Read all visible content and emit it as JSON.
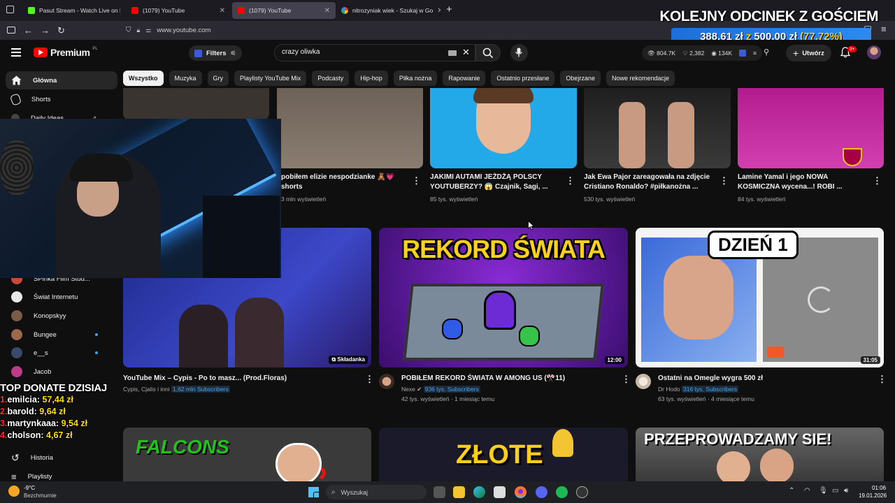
{
  "browser": {
    "tabs": [
      {
        "title": "Pasut Stream - Watch Live on K",
        "active": false
      },
      {
        "title": "(1079) YouTube",
        "active": false
      },
      {
        "title": "(1079) YouTube",
        "active": true
      },
      {
        "title": "nitrozyniak wiek - Szukaj w Go",
        "active": false
      }
    ],
    "url": "www.youtube.com"
  },
  "overlay": {
    "title": "KOLEJNY ODCINEK Z GOŚCIEM",
    "current": "388,61 zł",
    "z": "z",
    "goal": "500,00 zł",
    "percent": "(77.72%)",
    "progress_fraction": 0.7772,
    "top_title": "TOP DONATE DZISIAJ",
    "top": [
      {
        "rank": "1.",
        "name": "emilcia:",
        "amount": "57,44 zł"
      },
      {
        "rank": "2.",
        "name": "barold:",
        "amount": "9,64 zł"
      },
      {
        "rank": "3.",
        "name": "martynkaaa:",
        "amount": "9,54 zł"
      },
      {
        "rank": "4.",
        "name": "cholson:",
        "amount": "4,67 zł"
      }
    ]
  },
  "header": {
    "logo": "Premium",
    "logo_region": "PL",
    "filters": "Filters",
    "search_value": "crazy oliwka",
    "stats": {
      "views": "804.7K",
      "likes": "2,382",
      "watch": "134K"
    },
    "create": "Utwórz",
    "notif_badge": "9+"
  },
  "chips": [
    "Wszystko",
    "Muzyka",
    "Gry",
    "Playlisty YouTube Mix",
    "Podcasty",
    "Hip-hop",
    "Piłka nożna",
    "Rapowanie",
    "Ostatnio przesłane",
    "Obejrzane",
    "Nowe rekomendacje"
  ],
  "sidebar": {
    "main": [
      {
        "label": "Główna"
      },
      {
        "label": "Shorts"
      },
      {
        "label": "Daily Ideas"
      }
    ],
    "subs": [
      {
        "label": "SPinka Film Stud..."
      },
      {
        "label": "Świat Internetu"
      },
      {
        "label": "Konopskyy"
      },
      {
        "label": "Bungee"
      },
      {
        "label": "e__s"
      },
      {
        "label": "Jacob"
      }
    ],
    "bottom": [
      {
        "label": "Historia"
      },
      {
        "label": "Playlisty"
      }
    ]
  },
  "shorts_row": [
    {
      "title": "pobiłem elizie nespodzianke 🧸💗 shorts",
      "meta": "3 mln wyświetleń"
    },
    {
      "title": "JAKIMI AUTAMI JEŻDŻĄ POLSCY YOUTUBERZY? 😱 Czajnik, Sagi, ...",
      "meta": "85 tys. wyświetleń"
    },
    {
      "title": "Jak Ewa Pajor zareagowała na zdjęcie Cristiano Ronaldo? #piłkanożna ...",
      "meta": "530 tys. wyświetleń"
    },
    {
      "title": "Lamine Yamal i jego NOWA KOSMICZNA wycena...! ROBI ...",
      "meta": "84 tys. wyświetleń"
    }
  ],
  "videos": [
    {
      "title": "YouTube Mix – Cypis - Po to masz... (Prod.Floras)",
      "channel": "Cypis, Cjalis i inni",
      "subs": "1,62 mln",
      "subs_suffix": "Subscribers",
      "meta": "",
      "badge": "Składanka"
    },
    {
      "title": "POBIŁEM REKORD ŚWIATA W AMONG US (🎌11)",
      "channel": "Nexe",
      "subs": "936 tys.",
      "subs_suffix": "Subscribers",
      "meta": "42 tys. wyświetleń · 1 miesiąc temu",
      "duration": "12:00",
      "thumb_text": "REKORD ŚWIATA"
    },
    {
      "title": "Ostatni na Omegle wygra 500 zł",
      "channel": "Dr Hodo",
      "subs": "316 tys.",
      "subs_suffix": "Subscribers",
      "meta": "63 tys. wyświetleń · 4 miesiące temu",
      "duration": "31:05",
      "thumb_text": "DZIEŃ 1"
    }
  ],
  "bottom_row": [
    {
      "thumb_text": "FALCONS"
    },
    {
      "thumb_text": "ZŁOTE"
    },
    {
      "thumb_text": "PRZEPROWADZAMY SIE!"
    }
  ],
  "taskbar": {
    "weather_temp": "-9°C",
    "weather_desc": "Bezchmurnie",
    "search": "Wyszukaj",
    "time": "01:06",
    "date": "19.01.2026"
  }
}
